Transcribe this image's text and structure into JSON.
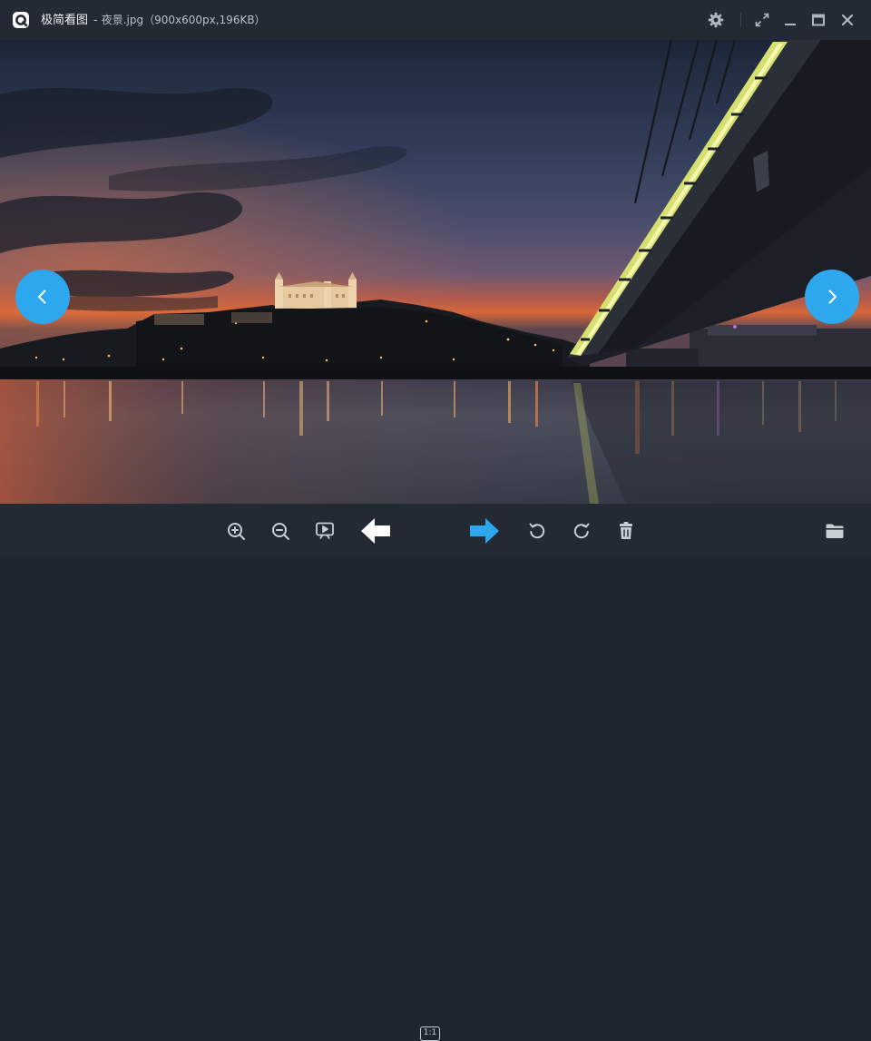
{
  "app": {
    "name": "极简看图",
    "separator": "-",
    "file_label": "夜景.jpg（900x600px,196KB）"
  },
  "titlebar": {
    "icons": [
      "app-logo-icon",
      "settings-gear-icon",
      "fullscreen-icon",
      "minimize-icon",
      "maximize-icon",
      "close-icon"
    ]
  },
  "viewer": {
    "image_description_icon": "night-bridge-photo",
    "prev_icon": "chevron-left-icon",
    "next_icon": "chevron-right-icon"
  },
  "toolbar": {
    "icons": [
      "zoom-in-icon",
      "zoom-out-icon",
      "slideshow-icon",
      "prev-image-arrow-icon",
      "actual-size-icon",
      "next-image-arrow-icon",
      "rotate-left-icon",
      "rotate-right-icon",
      "delete-icon",
      "open-folder-icon"
    ],
    "actual_size_label": "1:1"
  },
  "colors": {
    "titlebar_bg": "#232a33",
    "accent": "#2da7ee",
    "icon": "#c7ced6"
  }
}
